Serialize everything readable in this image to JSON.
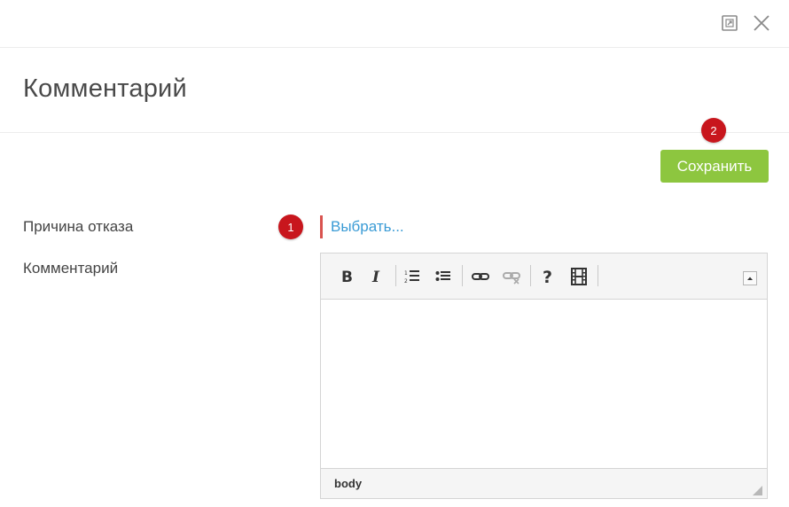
{
  "dialog": {
    "title": "Комментарий",
    "save_label": "Сохранить"
  },
  "markers": [
    "1",
    "2"
  ],
  "form": {
    "reason_label": "Причина отказа",
    "reason_value": "Выбрать...",
    "comment_label": "Комментарий"
  },
  "editor": {
    "toolbar_icons": [
      "bold-icon",
      "italic-icon",
      "ordered-list-icon",
      "unordered-list-icon",
      "link-icon",
      "unlink-icon",
      "help-icon",
      "video-icon"
    ],
    "status_path": "body",
    "content": ""
  },
  "colors": {
    "accent_green": "#8dc63f",
    "marker_red": "#c8161d",
    "link_blue": "#3a9bd5",
    "required_red": "#d9534f"
  }
}
